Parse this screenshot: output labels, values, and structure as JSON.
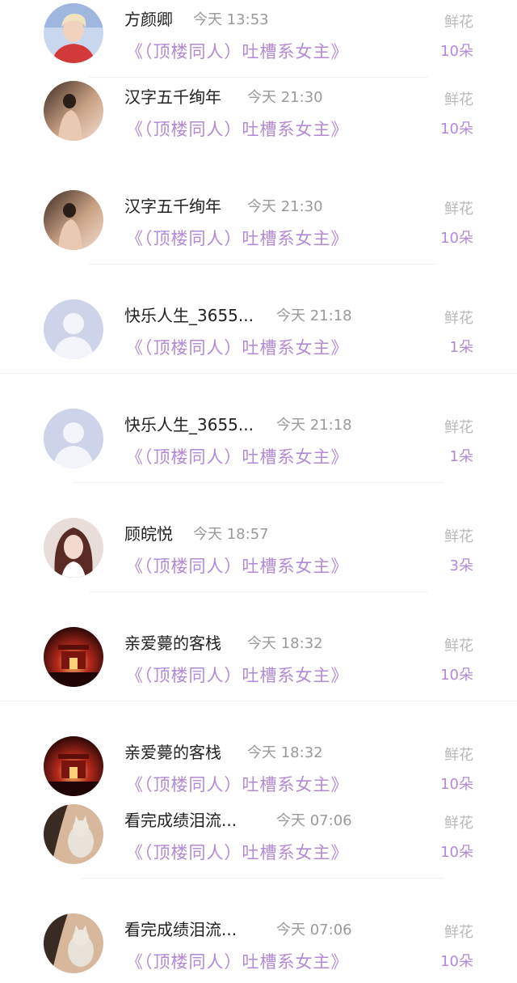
{
  "gift_label": "鲜花",
  "book_title": "《（顶楼同人）吐槽系女主》",
  "rows": [
    {
      "user": "方颜卿",
      "time": "今天 13:53",
      "count": "10朵",
      "avatar": "blonde-male-avatar"
    },
    {
      "user": "汉字五千绚年",
      "time": "今天 21:30",
      "count": "10朵",
      "avatar": "warm-room-figure-avatar"
    },
    {
      "user": "汉字五千绚年",
      "time": "今天 21:30",
      "count": "10朵",
      "avatar": "warm-room-figure-avatar"
    },
    {
      "user": "快乐人生_3655...",
      "time": "今天 21:18",
      "count": "1朵",
      "avatar": "default-user-avatar"
    },
    {
      "user": "快乐人生_3655...",
      "time": "今天 21:18",
      "count": "1朵",
      "avatar": "default-user-avatar"
    },
    {
      "user": "顾皖悦",
      "time": "今天 18:57",
      "count": "3朵",
      "avatar": "girl-portrait-avatar"
    },
    {
      "user": "亲爱薨的客栈",
      "time": "今天 18:32",
      "count": "10朵",
      "avatar": "red-palace-avatar"
    },
    {
      "user": "亲爱薨的客栈",
      "time": "今天 18:32",
      "count": "10朵",
      "avatar": "red-palace-avatar"
    },
    {
      "user": "看完成绩泪流...",
      "time": "今天 07:06",
      "count": "10朵",
      "avatar": "cat-portrait-avatar"
    },
    {
      "user": "看完成绩泪流...",
      "time": "今天 07:06",
      "count": "10朵",
      "avatar": "cat-portrait-avatar"
    }
  ],
  "colors": {
    "accent": "#b28ad6",
    "name": "#222222",
    "meta": "#9a9a9a",
    "gift": "#b8b8b8"
  }
}
